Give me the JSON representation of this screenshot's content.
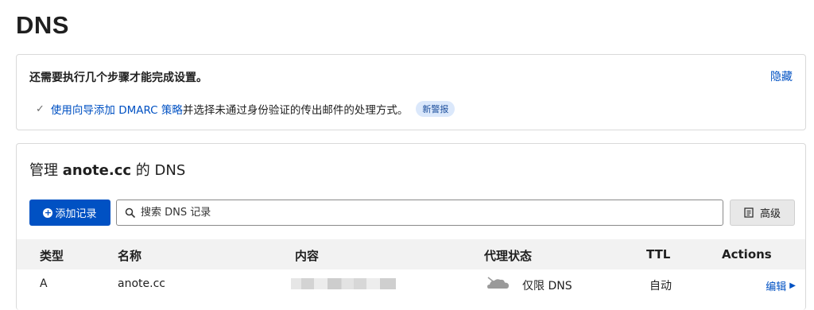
{
  "page": {
    "title": "DNS"
  },
  "setup": {
    "title": "还需要执行几个步骤才能完成设置。",
    "hide_label": "隐藏",
    "step_link": "使用向导添加 DMARC 策略",
    "step_text": "并选择未通过身份验证的传出邮件的处理方式。",
    "badge": "新警报"
  },
  "manage": {
    "title_prefix": "管理 ",
    "domain": "anote.cc",
    "title_suffix": " 的 DNS",
    "add_button": "添加记录",
    "search_placeholder": "搜索 DNS 记录",
    "advanced_button": "高级"
  },
  "table": {
    "columns": [
      "类型",
      "名称",
      "内容",
      "代理状态",
      "TTL",
      "Actions"
    ],
    "rows": [
      {
        "type": "A",
        "name": "anote.cc",
        "content": "",
        "proxy_status": "仅限 DNS",
        "ttl": "自动",
        "action": "编辑"
      }
    ]
  },
  "colors": {
    "accent": "#0051c3",
    "badge_bg": "#dbe8fb",
    "header_bg": "#f2f2f2"
  }
}
